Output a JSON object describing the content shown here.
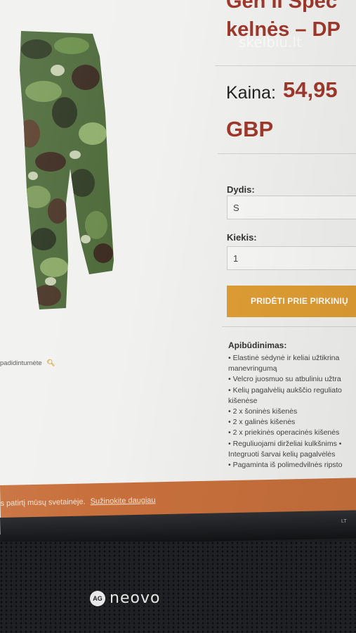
{
  "product": {
    "title_line1": "Gen II Spec",
    "title_line2": "kelnės – DP",
    "price_label": "Kaina:",
    "price_value": "54,95",
    "price_currency": "GBP"
  },
  "watermark": "skelbiu.lt",
  "options": {
    "size_label": "Dydis:",
    "size_value": "S",
    "qty_label": "Kiekis:",
    "qty_value": "1"
  },
  "add_to_cart_label": "PRIDĖTI PRIE PIRKINIŲ",
  "zoom_hint": "padidintumėte",
  "description": {
    "title": "Apibūdinimas:",
    "items": [
      "• Elastinė sėdynė ir keliai užtikrina",
      "manevringumą",
      "• Velcro juosmuo su atbuliniu užtra",
      "• Kelių pagalvėlių aukščio reguliato",
      "kišenėse",
      "• 2 x šoninės kišenės",
      "• 2 x galinės kišenės",
      "• 2 x priekinės operacinės kišenės",
      "• Reguliuojami dirželiai kulkšnims •",
      "Integruoti šarvai kelių pagalvėlės",
      "• Pagaminta iš polimedvilnės ripsto"
    ]
  },
  "cookie": {
    "text": "s patirtį mūsų svetainėje.",
    "link": "Sužinokite daugiau"
  },
  "monitor": {
    "brand_badge": "AG",
    "brand_name": "neovo",
    "lang_badge": "LT"
  },
  "colors": {
    "accent_red": "#a0382c",
    "button_orange": "#e09e34",
    "cookie_bar": "#c8703c"
  }
}
